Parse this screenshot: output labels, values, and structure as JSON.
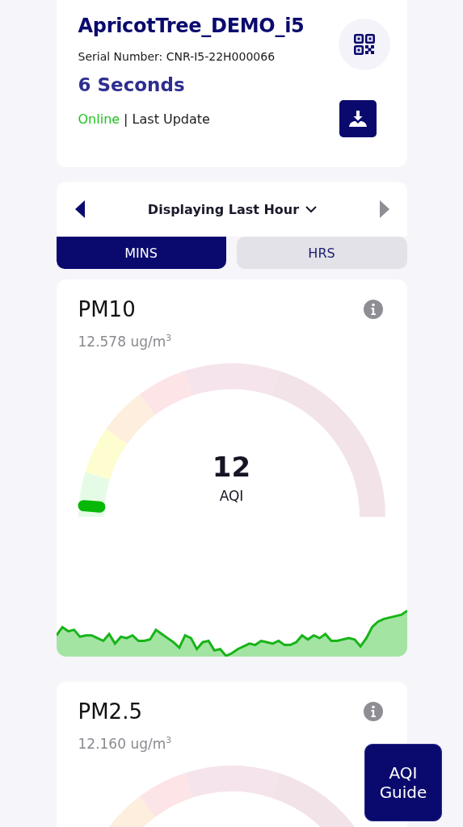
{
  "device": {
    "name": "ApricotTree_DEMO_i5",
    "serial": "Serial Number: CNR-I5-22H000066",
    "last_update": "6 Seconds",
    "status": "Online",
    "status_suffix": "| Last Update"
  },
  "range": {
    "label": "Displaying Last Hour"
  },
  "tabs": [
    {
      "label": "MINS",
      "selected": true
    },
    {
      "label": "HRS",
      "selected": false
    }
  ],
  "sensors": [
    {
      "name": "PM10",
      "reading": "12.578 ug/m$^{3}$",
      "aqi": "12",
      "aqi_label": "AQI"
    },
    {
      "name": "PM2.5",
      "reading": "12.160 ug/m$^{3}$"
    }
  ],
  "guide_button": {
    "label": "AQI\nGuide"
  }
}
